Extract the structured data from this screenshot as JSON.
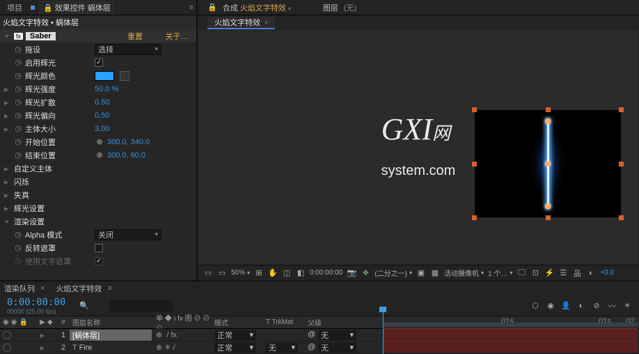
{
  "left_panel": {
    "tab_project": "项目",
    "tab_effects": "效果控件",
    "tab_effects_suffix": "蜗体层",
    "breadcrumb": "火焰文字特效 • 蜗体层",
    "fx_tag": "fx",
    "effect_name": "Saber",
    "link_reset": "重置",
    "link_about": "关于…",
    "rows": {
      "preset_label": "拖设",
      "preset_value": "选择",
      "enable_glow": "启用辉光",
      "glow_color": "辉光颜色",
      "glow_intensity": "辉光强度",
      "glow_intensity_val": "50.0 %",
      "glow_spread": "辉光扩散",
      "glow_spread_val": "0.50",
      "glow_bias": "辉光偏向",
      "glow_bias_val": "0.50",
      "body_size": "主体大小",
      "body_size_val": "3.00",
      "start_pos": "开始位置",
      "start_pos_val": "300.0, 340.0",
      "end_pos": "结束位置",
      "end_pos_val": "300.0, 60.0",
      "custom_body": "自定义主体",
      "flicker": "闪烁",
      "distort": "失真",
      "glow_settings": "辉光设置",
      "render_settings": "渲染设置",
      "alpha_mode": "Alpha 模式",
      "alpha_mode_val": "关闭",
      "invert_mask": "反转遮罩",
      "use_text_mask": "使用文字遮罩"
    }
  },
  "comp_panel": {
    "tab_comp": "合成",
    "tab_comp_name": "火焰文字特效",
    "layers_label": "图层",
    "layers_none": "(无)",
    "sub_tab": "火焰文字特效",
    "watermark_main": "GXI",
    "watermark_sub": "网",
    "watermark_sys": "system.com",
    "toolbar": {
      "zoom": "50%",
      "time": "0:00:00:00",
      "res": "(二分之一)",
      "camera": "活动摄像机",
      "views": "1 个…",
      "exposure": "+0.0"
    }
  },
  "timeline": {
    "tab_render_queue": "渲染队列",
    "tab_comp": "火焰文字特效",
    "timecode": "0:00:00:00",
    "timecode_sub": "00000 (25.00 fps)",
    "col_layer_no": "#",
    "col_layer_name": "图层名称",
    "col_switches": "单 ◆ \\ fx 图 ⊘ ⊘ ⊙",
    "col_mode": "模式",
    "col_trkmat": "T  TrkMat",
    "col_parent": "父级",
    "layer1_name": "[蜗体层]",
    "layer1_mode": "正常",
    "layer1_trk": "",
    "layer1_parent": "无",
    "layer2_name": "Fire",
    "layer2_mode": "正常",
    "layer2_trk": "无",
    "layer2_parent": "无",
    "ruler_01s_a": "01s",
    "ruler_01s_b": "01s",
    "ruler_02": "02"
  }
}
